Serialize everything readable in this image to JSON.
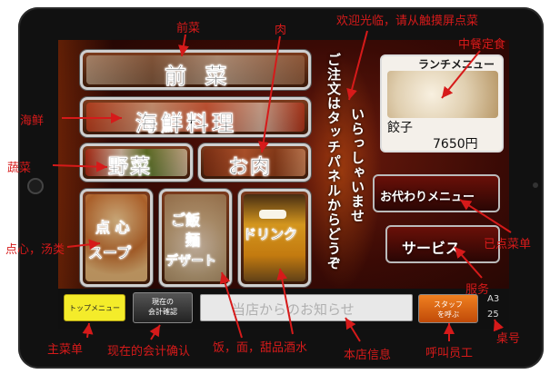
{
  "colors": {
    "annotation": "#d61a1a",
    "top_menu_bg": "#f4ec2a",
    "staff_bg": "#e0601a"
  },
  "menu": {
    "zensai": "前 菜",
    "kaisen": "海鮮料理",
    "yasai": "野菜",
    "niku": "お肉",
    "tenshin_l1": "点 心",
    "tenshin_l2": "スープ",
    "gohan_l1": "ご飯",
    "gohan_l2": "麺",
    "gohan_l3": "デザート",
    "drink": "ドリンク"
  },
  "welcome": {
    "line1": "いらっしゃいませ",
    "line2": "ご注文はタッチパネルからどうぞ"
  },
  "lunch": {
    "title": "ランチメニュー",
    "item": "餃子",
    "price": "7650円"
  },
  "side": {
    "okawari": "お代わりメニュー",
    "service": "サービス"
  },
  "bottom": {
    "top_menu": "トップメニュー",
    "kaikei_l1": "現在の",
    "kaikei_l2": "会計確認",
    "notice": "当店からのお知らせ",
    "staff_l1": "スタッフ",
    "staff_l2": "を呼ぶ",
    "table_label": "A3",
    "table_number": "25"
  },
  "annotations": {
    "zensai": "前菜",
    "niku": "肉",
    "welcome": "欢迎光临，请从触摸屏点菜",
    "lunch": "中餐定食",
    "kaisen": "海鲜",
    "yasai": "蔬菜",
    "tenshin": "点心，汤类",
    "okawari": "已点菜单",
    "service": "服务",
    "table": "桌号",
    "top_menu": "主菜单",
    "kaikei": "现在的会计确认",
    "gohan_drink": "饭，面，甜品酒水",
    "notice": "本店信息",
    "staff": "呼叫员工"
  }
}
